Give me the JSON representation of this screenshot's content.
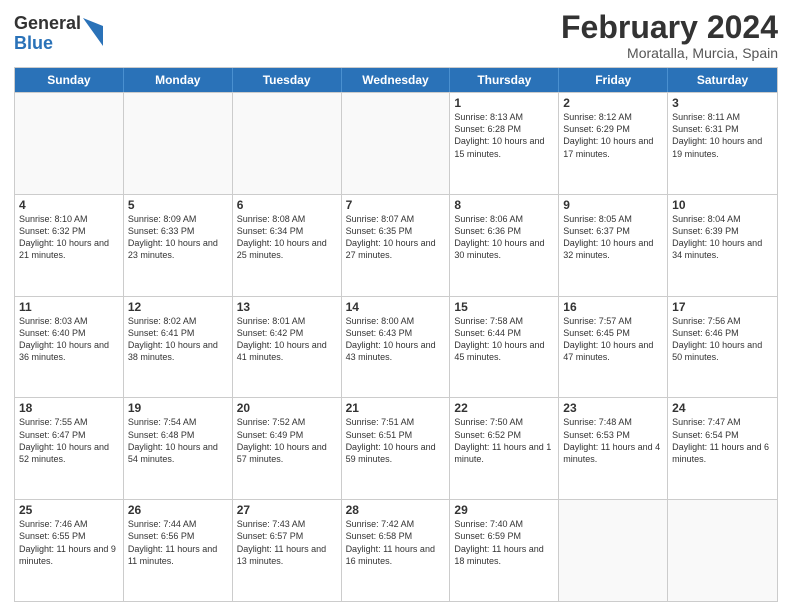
{
  "logo": {
    "general": "General",
    "blue": "Blue"
  },
  "title": "February 2024",
  "subtitle": "Moratalla, Murcia, Spain",
  "headers": [
    "Sunday",
    "Monday",
    "Tuesday",
    "Wednesday",
    "Thursday",
    "Friday",
    "Saturday"
  ],
  "weeks": [
    [
      {
        "day": "",
        "sunrise": "",
        "sunset": "",
        "daylight": "",
        "empty": true
      },
      {
        "day": "",
        "sunrise": "",
        "sunset": "",
        "daylight": "",
        "empty": true
      },
      {
        "day": "",
        "sunrise": "",
        "sunset": "",
        "daylight": "",
        "empty": true
      },
      {
        "day": "",
        "sunrise": "",
        "sunset": "",
        "daylight": "",
        "empty": true
      },
      {
        "day": "1",
        "sunrise": "Sunrise: 8:13 AM",
        "sunset": "Sunset: 6:28 PM",
        "daylight": "Daylight: 10 hours and 15 minutes."
      },
      {
        "day": "2",
        "sunrise": "Sunrise: 8:12 AM",
        "sunset": "Sunset: 6:29 PM",
        "daylight": "Daylight: 10 hours and 17 minutes."
      },
      {
        "day": "3",
        "sunrise": "Sunrise: 8:11 AM",
        "sunset": "Sunset: 6:31 PM",
        "daylight": "Daylight: 10 hours and 19 minutes."
      }
    ],
    [
      {
        "day": "4",
        "sunrise": "Sunrise: 8:10 AM",
        "sunset": "Sunset: 6:32 PM",
        "daylight": "Daylight: 10 hours and 21 minutes."
      },
      {
        "day": "5",
        "sunrise": "Sunrise: 8:09 AM",
        "sunset": "Sunset: 6:33 PM",
        "daylight": "Daylight: 10 hours and 23 minutes."
      },
      {
        "day": "6",
        "sunrise": "Sunrise: 8:08 AM",
        "sunset": "Sunset: 6:34 PM",
        "daylight": "Daylight: 10 hours and 25 minutes."
      },
      {
        "day": "7",
        "sunrise": "Sunrise: 8:07 AM",
        "sunset": "Sunset: 6:35 PM",
        "daylight": "Daylight: 10 hours and 27 minutes."
      },
      {
        "day": "8",
        "sunrise": "Sunrise: 8:06 AM",
        "sunset": "Sunset: 6:36 PM",
        "daylight": "Daylight: 10 hours and 30 minutes."
      },
      {
        "day": "9",
        "sunrise": "Sunrise: 8:05 AM",
        "sunset": "Sunset: 6:37 PM",
        "daylight": "Daylight: 10 hours and 32 minutes."
      },
      {
        "day": "10",
        "sunrise": "Sunrise: 8:04 AM",
        "sunset": "Sunset: 6:39 PM",
        "daylight": "Daylight: 10 hours and 34 minutes."
      }
    ],
    [
      {
        "day": "11",
        "sunrise": "Sunrise: 8:03 AM",
        "sunset": "Sunset: 6:40 PM",
        "daylight": "Daylight: 10 hours and 36 minutes."
      },
      {
        "day": "12",
        "sunrise": "Sunrise: 8:02 AM",
        "sunset": "Sunset: 6:41 PM",
        "daylight": "Daylight: 10 hours and 38 minutes."
      },
      {
        "day": "13",
        "sunrise": "Sunrise: 8:01 AM",
        "sunset": "Sunset: 6:42 PM",
        "daylight": "Daylight: 10 hours and 41 minutes."
      },
      {
        "day": "14",
        "sunrise": "Sunrise: 8:00 AM",
        "sunset": "Sunset: 6:43 PM",
        "daylight": "Daylight: 10 hours and 43 minutes."
      },
      {
        "day": "15",
        "sunrise": "Sunrise: 7:58 AM",
        "sunset": "Sunset: 6:44 PM",
        "daylight": "Daylight: 10 hours and 45 minutes."
      },
      {
        "day": "16",
        "sunrise": "Sunrise: 7:57 AM",
        "sunset": "Sunset: 6:45 PM",
        "daylight": "Daylight: 10 hours and 47 minutes."
      },
      {
        "day": "17",
        "sunrise": "Sunrise: 7:56 AM",
        "sunset": "Sunset: 6:46 PM",
        "daylight": "Daylight: 10 hours and 50 minutes."
      }
    ],
    [
      {
        "day": "18",
        "sunrise": "Sunrise: 7:55 AM",
        "sunset": "Sunset: 6:47 PM",
        "daylight": "Daylight: 10 hours and 52 minutes."
      },
      {
        "day": "19",
        "sunrise": "Sunrise: 7:54 AM",
        "sunset": "Sunset: 6:48 PM",
        "daylight": "Daylight: 10 hours and 54 minutes."
      },
      {
        "day": "20",
        "sunrise": "Sunrise: 7:52 AM",
        "sunset": "Sunset: 6:49 PM",
        "daylight": "Daylight: 10 hours and 57 minutes."
      },
      {
        "day": "21",
        "sunrise": "Sunrise: 7:51 AM",
        "sunset": "Sunset: 6:51 PM",
        "daylight": "Daylight: 10 hours and 59 minutes."
      },
      {
        "day": "22",
        "sunrise": "Sunrise: 7:50 AM",
        "sunset": "Sunset: 6:52 PM",
        "daylight": "Daylight: 11 hours and 1 minute."
      },
      {
        "day": "23",
        "sunrise": "Sunrise: 7:48 AM",
        "sunset": "Sunset: 6:53 PM",
        "daylight": "Daylight: 11 hours and 4 minutes."
      },
      {
        "day": "24",
        "sunrise": "Sunrise: 7:47 AM",
        "sunset": "Sunset: 6:54 PM",
        "daylight": "Daylight: 11 hours and 6 minutes."
      }
    ],
    [
      {
        "day": "25",
        "sunrise": "Sunrise: 7:46 AM",
        "sunset": "Sunset: 6:55 PM",
        "daylight": "Daylight: 11 hours and 9 minutes."
      },
      {
        "day": "26",
        "sunrise": "Sunrise: 7:44 AM",
        "sunset": "Sunset: 6:56 PM",
        "daylight": "Daylight: 11 hours and 11 minutes."
      },
      {
        "day": "27",
        "sunrise": "Sunrise: 7:43 AM",
        "sunset": "Sunset: 6:57 PM",
        "daylight": "Daylight: 11 hours and 13 minutes."
      },
      {
        "day": "28",
        "sunrise": "Sunrise: 7:42 AM",
        "sunset": "Sunset: 6:58 PM",
        "daylight": "Daylight: 11 hours and 16 minutes."
      },
      {
        "day": "29",
        "sunrise": "Sunrise: 7:40 AM",
        "sunset": "Sunset: 6:59 PM",
        "daylight": "Daylight: 11 hours and 18 minutes."
      },
      {
        "day": "",
        "sunrise": "",
        "sunset": "",
        "daylight": "",
        "empty": true
      },
      {
        "day": "",
        "sunrise": "",
        "sunset": "",
        "daylight": "",
        "empty": true
      }
    ]
  ]
}
